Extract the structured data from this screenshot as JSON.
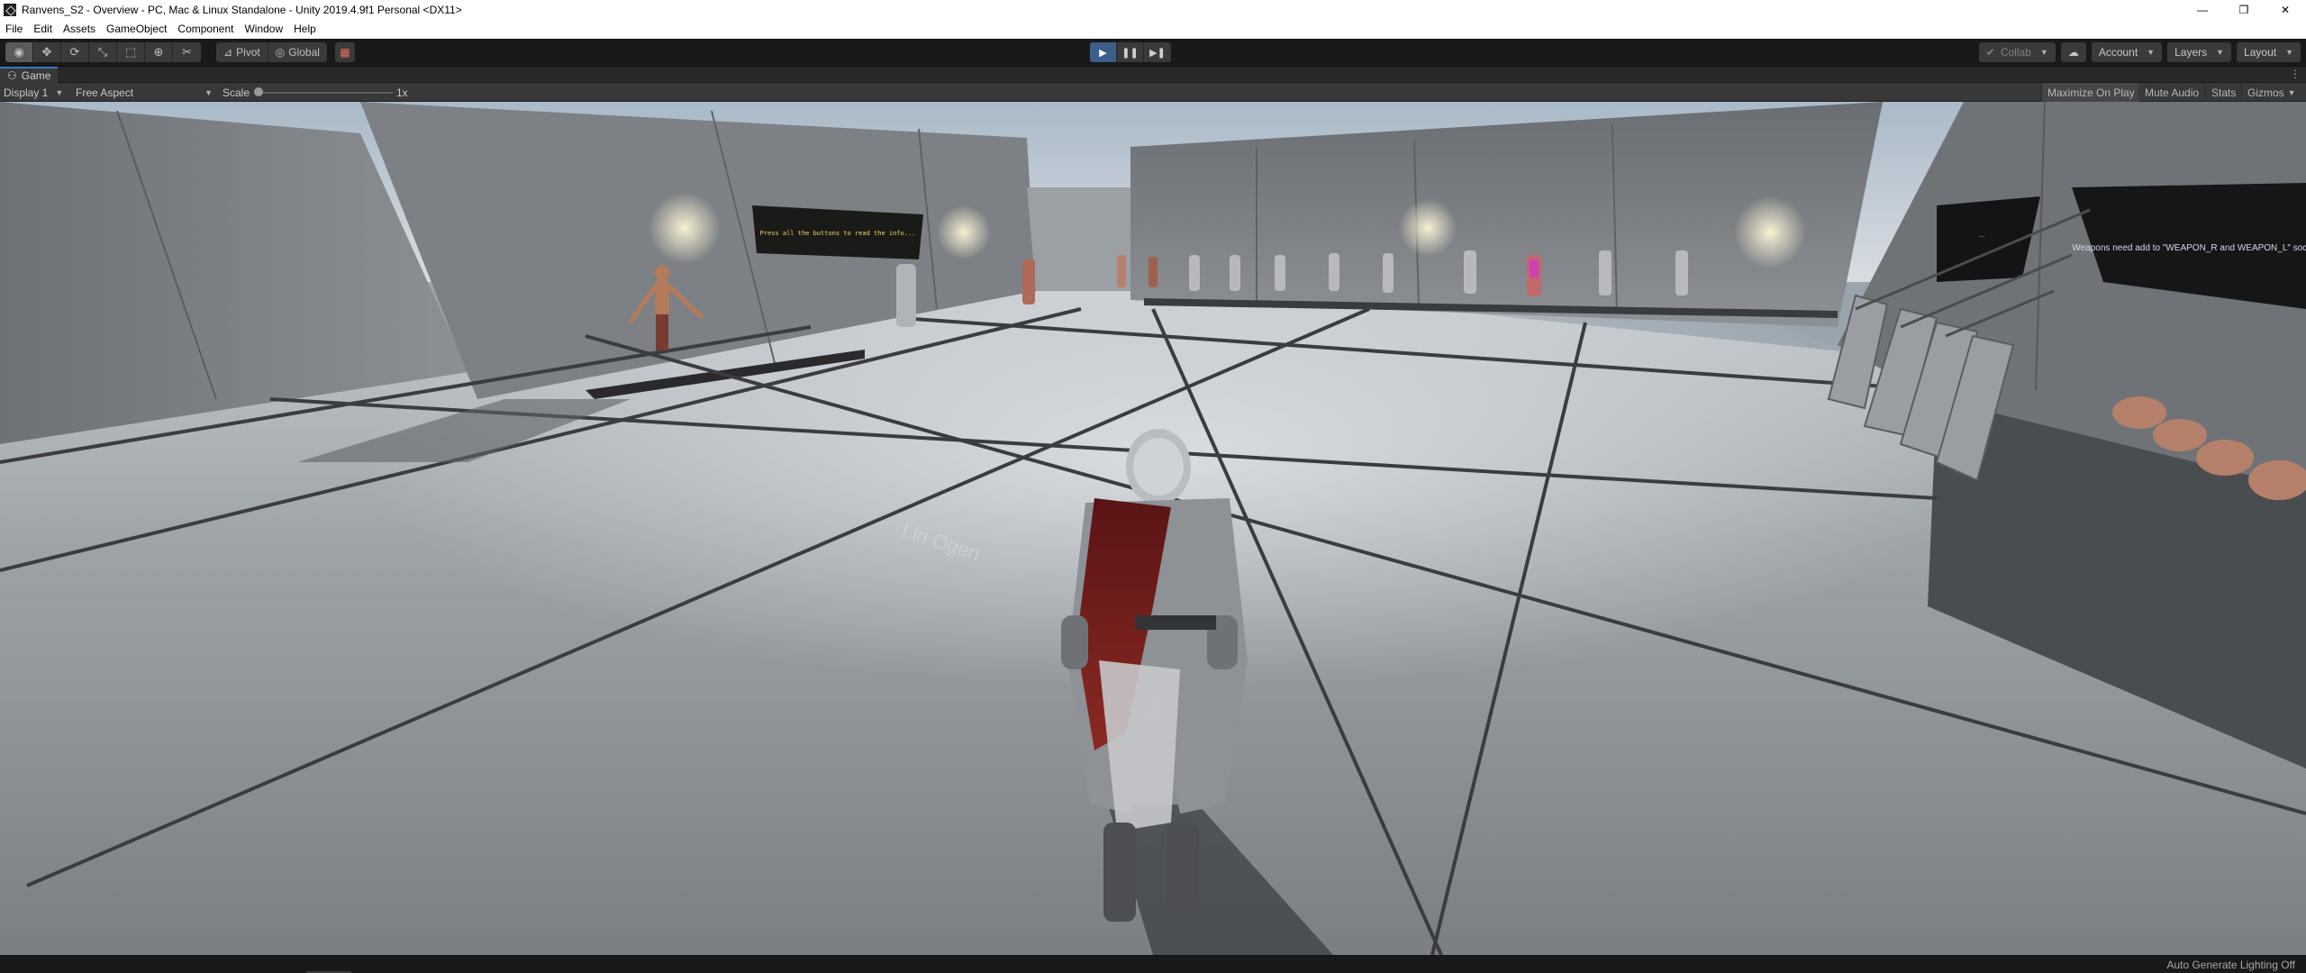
{
  "window": {
    "title": "Ranvens_S2 - Overview - PC, Mac & Linux Standalone - Unity 2019.4.9f1 Personal <DX11>",
    "controls": {
      "minimize": "—",
      "restore": "❐",
      "close": "✕"
    }
  },
  "menu": {
    "items": [
      "File",
      "Edit",
      "Assets",
      "GameObject",
      "Component",
      "Window",
      "Help"
    ]
  },
  "toolbar": {
    "tools": [
      {
        "name": "view-tool",
        "icon": "eye-icon",
        "glyph": "◉"
      },
      {
        "name": "move-tool",
        "icon": "move-icon",
        "glyph": "✥"
      },
      {
        "name": "rotate-tool",
        "icon": "rotate-icon",
        "glyph": "⟳"
      },
      {
        "name": "scale-tool",
        "icon": "scale-icon",
        "glyph": "⤡"
      },
      {
        "name": "rect-tool",
        "icon": "rect-icon",
        "glyph": "⬚"
      },
      {
        "name": "transform-tool",
        "icon": "transform-icon",
        "glyph": "⊕"
      },
      {
        "name": "custom-tool",
        "icon": "wrench-icon",
        "glyph": "✂"
      }
    ],
    "pivot_label": "Pivot",
    "global_label": "Global",
    "play": {
      "play": "▶",
      "pause": "❚❚",
      "step": "▶❚"
    },
    "collab_label": "Collab",
    "account_label": "Account",
    "layers_label": "Layers",
    "layout_label": "Layout"
  },
  "game_tab": {
    "label": "Game",
    "icon": "game-controller-icon"
  },
  "game_toolbar": {
    "display_label": "Display 1",
    "aspect_label": "Free Aspect",
    "scale_label": "Scale",
    "scale_value": "1x",
    "scale_fraction": 0.0,
    "maximize_label": "Maximize On Play",
    "mute_label": "Mute Audio",
    "stats_label": "Stats",
    "gizmos_label": "Gizmos"
  },
  "scene": {
    "sign_left_text": "Press all the buttons to read the info...",
    "sign_right_text": "Weapons need add to \"WEAPON_R and WEAPON_L\" sockets",
    "sign_far_right_text": "...",
    "floor_text": "Lin  Ogen"
  },
  "status": {
    "lighting_text": "Auto Generate Lighting Off"
  },
  "colors": {
    "play_active": "#3c5f8a",
    "tab_accent": "#3a79bb"
  }
}
